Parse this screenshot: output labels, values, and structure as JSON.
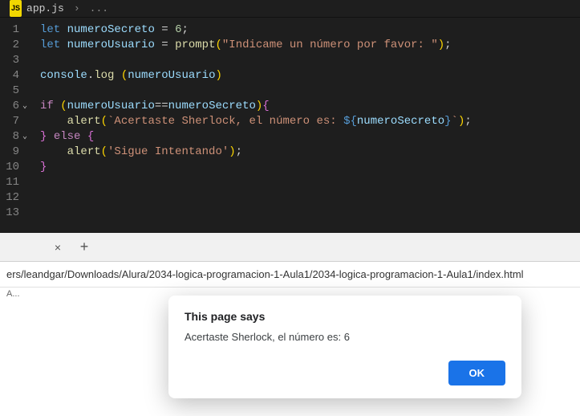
{
  "editor": {
    "file_icon": "JS",
    "file_name": "app.js",
    "crumb_sep": "›",
    "crumb_more": "...",
    "line_numbers": [
      "1",
      "2",
      "3",
      "4",
      "5",
      "6",
      "7",
      "8",
      "9",
      "10",
      "11",
      "12",
      "13"
    ],
    "code": {
      "l1": {
        "let": "let",
        "v": "numeroSecreto",
        "eq": " = ",
        "num": "6",
        "semi": ";"
      },
      "l2": {
        "let": "let",
        "v": "numeroUsuario",
        "eq": " = ",
        "fn": "prompt",
        "lp": "(",
        "str": "\"Indicame un número por favor: \"",
        "rp": ")",
        "semi": ";"
      },
      "l4": {
        "obj": "console",
        "dot": ".",
        "fn": "log",
        "sp": " ",
        "lp": "(",
        "arg": "numeroUsuario",
        "rp": ")"
      },
      "l6": {
        "if": "if",
        "sp": " ",
        "lp": "(",
        "a": "numeroUsuario",
        "op": "==",
        "b": "numeroSecreto",
        "rp": ")",
        "lb": "{"
      },
      "l7": {
        "fn": "alert",
        "lp": "(",
        "s1": "`Acertaste Sherlock, el número es: ",
        "ts": "${",
        "tv": "numeroSecreto",
        "te": "}",
        "s2": "`",
        "rp": ")",
        "semi": ";"
      },
      "l8": {
        "rb": "}",
        "sp": " ",
        "else": "else",
        "sp2": " ",
        "lb": "{"
      },
      "l9": {
        "fn": "alert",
        "lp": "(",
        "str": "'Sigue Intentando'",
        "rp": ")",
        "semi": ";"
      },
      "l10": {
        "rb": "}"
      }
    }
  },
  "browser": {
    "url": "ers/leandgar/Downloads/Alura/2034-logica-programacion-1-Aula1/2034-logica-programacion-1-Aula1/index.html",
    "subbar": "A...",
    "alert": {
      "title": "This page says",
      "message": "Acertaste Sherlock, el número es: 6",
      "ok": "OK"
    }
  }
}
